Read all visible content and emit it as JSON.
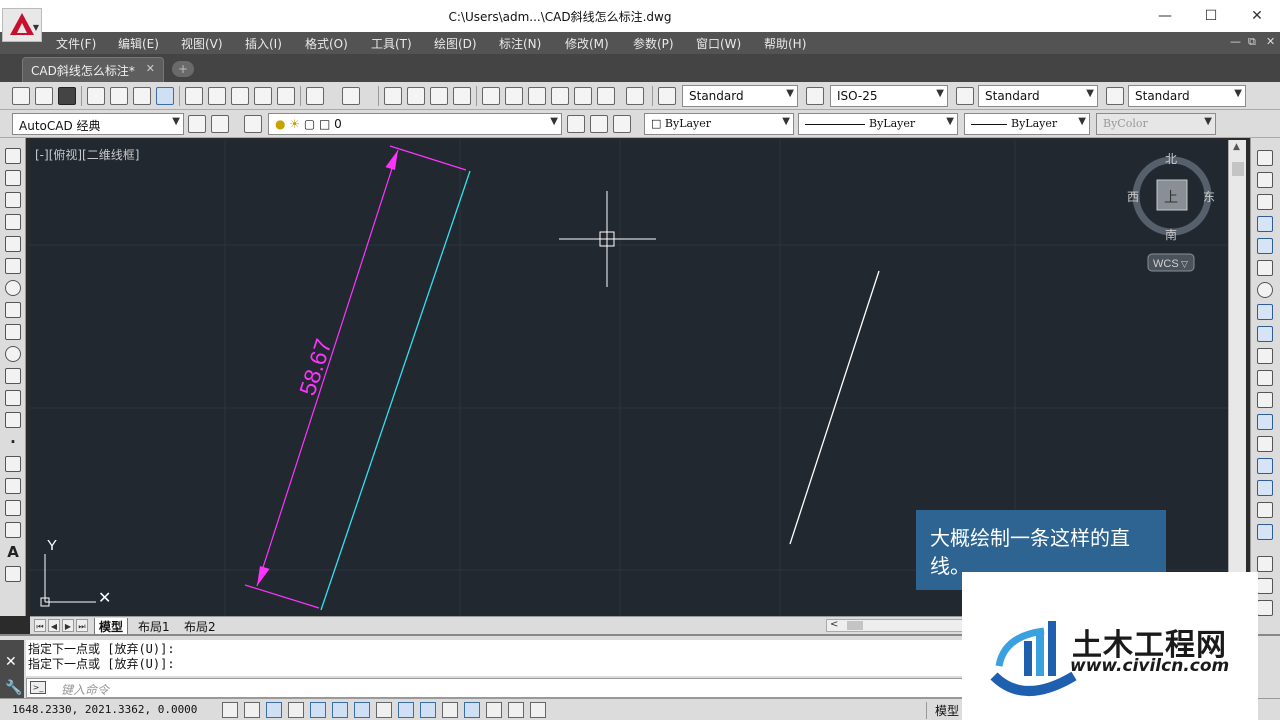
{
  "window": {
    "title": "C:\\Users\\adm...\\CAD斜线怎么标注.dwg",
    "minimize": "—",
    "maximize": "☐",
    "close": "✕"
  },
  "menu": {
    "items": [
      "文件(F)",
      "编辑(E)",
      "视图(V)",
      "插入(I)",
      "格式(O)",
      "工具(T)",
      "绘图(D)",
      "标注(N)",
      "修改(M)",
      "参数(P)",
      "窗口(W)",
      "帮助(H)"
    ],
    "mdi_minimize": "—",
    "mdi_restore": "⧉",
    "mdi_close": "✕"
  },
  "tabs": {
    "document": "CAD斜线怎么标注*",
    "close": "✕",
    "new_tab": "+"
  },
  "toolbar1": {
    "text_style": "Standard",
    "dim_style": "ISO-25",
    "table_style": "Standard",
    "multileader_style": "Standard"
  },
  "toolbar2": {
    "workspace": "AutoCAD 经典",
    "layer": "0",
    "color": "ByLayer",
    "linetype": "ByLayer",
    "lineweight": "ByLayer",
    "plotstyle": "ByColor"
  },
  "viewport": {
    "label": "[-][俯视][二维线框]",
    "dimension_text": "58.67",
    "viewcube": {
      "north": "北",
      "south": "南",
      "east": "东",
      "west": "西",
      "face": "上",
      "wcs": "WCS"
    },
    "ucs_y": "Y",
    "colors": {
      "background": "#212830",
      "grid": "#2c3440",
      "dimension": "#ff33ff",
      "aligned_line": "#33e0f0",
      "line": "#ffffff"
    }
  },
  "layout_tabs": [
    "模型",
    "布局1",
    "布局2"
  ],
  "command": {
    "history": [
      "指定下一点或 [放弃(U)]:",
      "指定下一点或 [放弃(U)]:"
    ],
    "placeholder": "键入命令"
  },
  "status": {
    "coords": "1648.2330, 2021.3362, 0.0000",
    "model": "模型"
  },
  "caption": {
    "text": "大概绘制一条这样的直线。"
  },
  "watermark": {
    "name": "土木工程网",
    "url": "www.civilcn.com"
  }
}
